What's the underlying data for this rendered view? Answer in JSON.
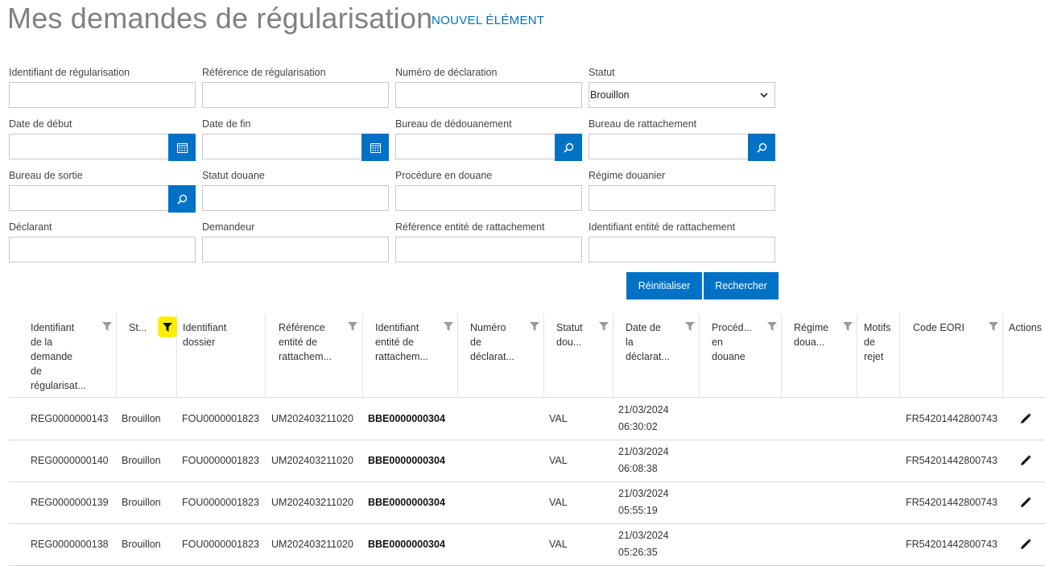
{
  "header": {
    "title": "Mes demandes de régularisation",
    "new_item": "NOUVEL ÉLÉMENT"
  },
  "filters": {
    "regularisation_id": {
      "label": "Identifiant de régularisation",
      "value": ""
    },
    "regularisation_ref": {
      "label": "Référence de régularisation",
      "value": ""
    },
    "declaration_number": {
      "label": "Numéro de déclaration",
      "value": ""
    },
    "status": {
      "label": "Statut",
      "value": "Brouillon"
    },
    "start_date": {
      "label": "Date de début",
      "value": ""
    },
    "end_date": {
      "label": "Date de fin",
      "value": ""
    },
    "customs_office": {
      "label": "Bureau de dédouanement",
      "value": ""
    },
    "attachment_office": {
      "label": "Bureau de rattachement",
      "value": ""
    },
    "exit_office": {
      "label": "Bureau de sortie",
      "value": ""
    },
    "customs_status": {
      "label": "Statut douane",
      "value": ""
    },
    "customs_procedure": {
      "label": "Procédure en douane",
      "value": ""
    },
    "customs_regime": {
      "label": "Régime douanier",
      "value": ""
    },
    "declarant": {
      "label": "Déclarant",
      "value": ""
    },
    "requester": {
      "label": "Demandeur",
      "value": ""
    },
    "entity_ref": {
      "label": "Référence entité de rattachement",
      "value": ""
    },
    "entity_id": {
      "label": "Identifiant entité de rattachement",
      "value": ""
    }
  },
  "buttons": {
    "reset": "Réinitialiser",
    "search": "Rechercher"
  },
  "table": {
    "headers": {
      "id": [
        "Identifiant",
        "de la",
        "demande",
        "de",
        "régularisat..."
      ],
      "status": [
        "St..."
      ],
      "dossier": [
        "Identifiant",
        "dossier"
      ],
      "entity_ref": [
        "Référence",
        "entité de",
        "rattachem..."
      ],
      "entity_id": [
        "Identifiant",
        "entité de",
        "rattachem..."
      ],
      "decl_number": [
        "Numéro",
        "de",
        "déclarat..."
      ],
      "customs_status": [
        "Statut",
        "dou..."
      ],
      "decl_date": [
        "Date de",
        "la",
        "déclarat..."
      ],
      "procedure": [
        "Procéd...",
        "en",
        "douane"
      ],
      "regime": [
        "Régime",
        "doua..."
      ],
      "rejection": [
        "Motifs",
        "de",
        "rejet"
      ],
      "eori": [
        "Code EORI"
      ],
      "actions": [
        "Actions"
      ]
    },
    "rows": [
      {
        "id": "REG0000000143",
        "status": "Brouillon",
        "dossier": "FOU0000001823",
        "entity_ref": "UM202403211020",
        "entity_id": "BBE0000000304",
        "customs_status": "VAL",
        "date": "21/03/2024",
        "time": "06:30:02",
        "eori": "FR54201442800743"
      },
      {
        "id": "REG0000000140",
        "status": "Brouillon",
        "dossier": "FOU0000001823",
        "entity_ref": "UM202403211020",
        "entity_id": "BBE0000000304",
        "customs_status": "VAL",
        "date": "21/03/2024",
        "time": "06:08:38",
        "eori": "FR54201442800743"
      },
      {
        "id": "REG0000000139",
        "status": "Brouillon",
        "dossier": "FOU0000001823",
        "entity_ref": "UM202403211020",
        "entity_id": "BBE0000000304",
        "customs_status": "VAL",
        "date": "21/03/2024",
        "time": "05:55:19",
        "eori": "FR54201442800743"
      },
      {
        "id": "REG0000000138",
        "status": "Brouillon",
        "dossier": "FOU0000001823",
        "entity_ref": "UM202403211020",
        "entity_id": "BBE0000000304",
        "customs_status": "VAL",
        "date": "21/03/2024",
        "time": "05:26:35",
        "eori": "FR54201442800743"
      }
    ]
  },
  "icons": {
    "calendar": "calendar-icon",
    "lookup": "search-icon",
    "filter": "filter-icon",
    "edit": "pencil-icon"
  },
  "colors": {
    "accent": "#0072c6",
    "filter_active": "#ffee00",
    "title_gray": "#808080"
  }
}
